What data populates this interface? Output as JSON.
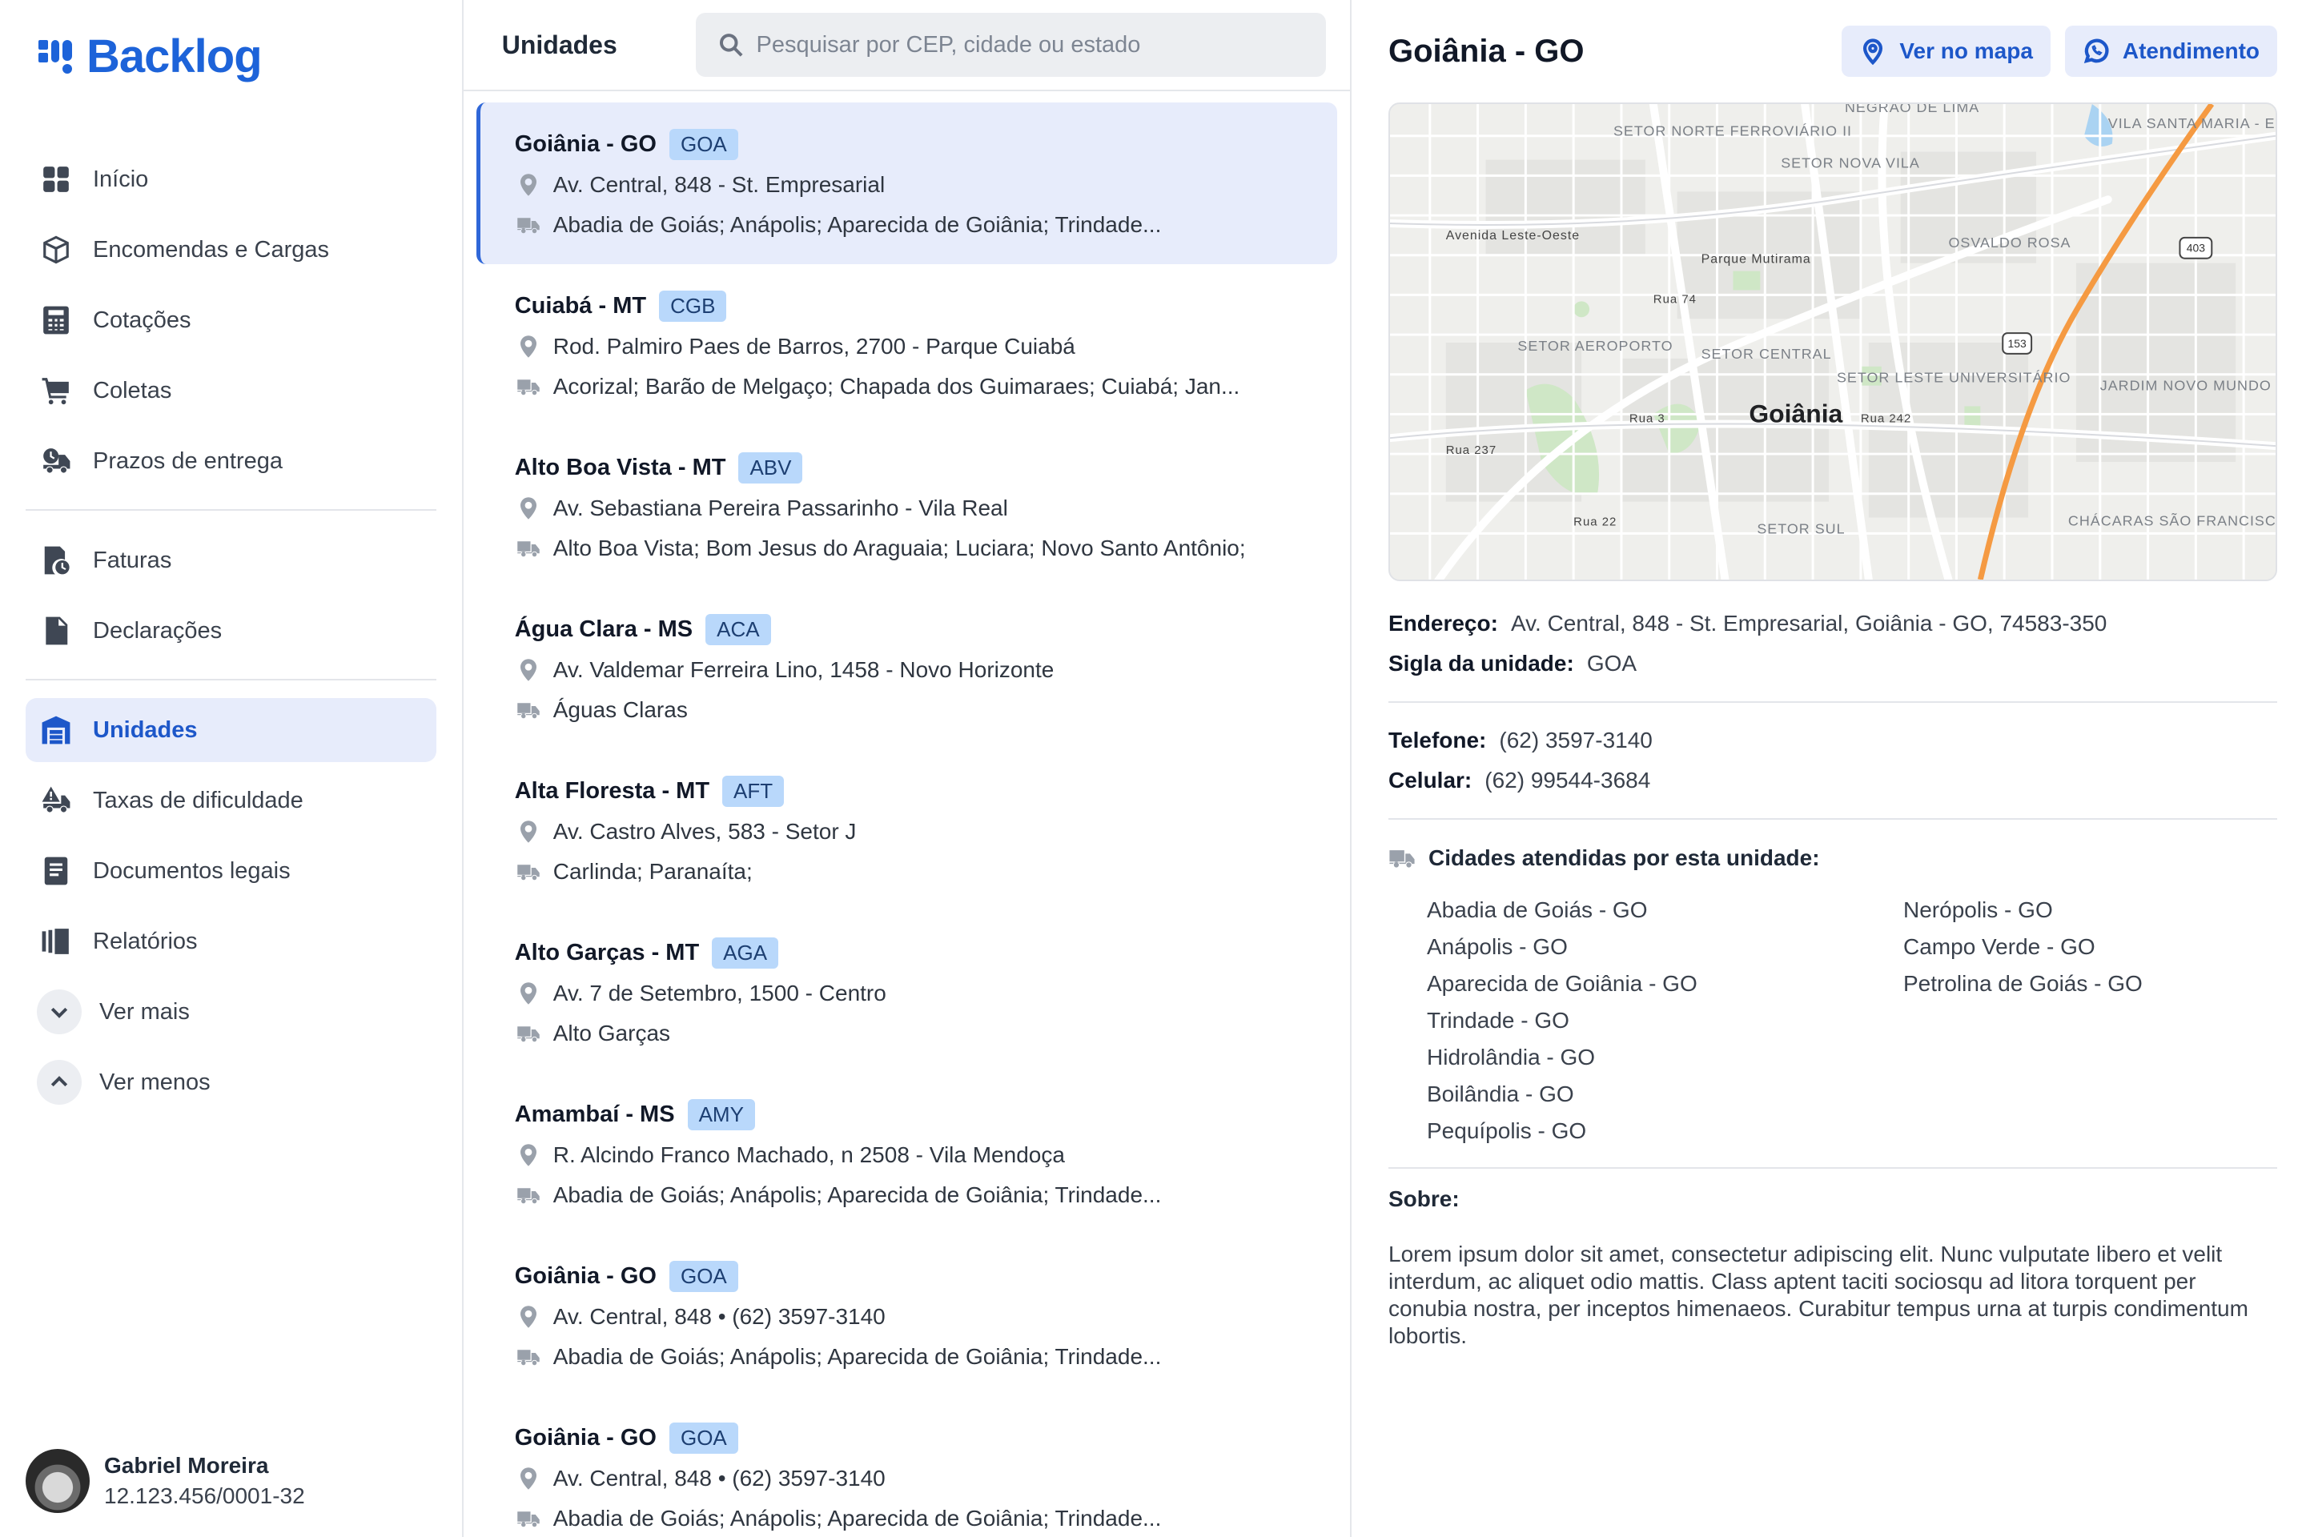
{
  "brand": {
    "name": "Backlog",
    "color": "#1d63d9"
  },
  "sidebar": {
    "items": [
      {
        "label": "Início",
        "icon": "grid-icon",
        "active": false
      },
      {
        "label": "Encomendas e Cargas",
        "icon": "box-icon",
        "active": false
      },
      {
        "label": "Cotações",
        "icon": "calculator-icon",
        "active": false
      },
      {
        "label": "Coletas",
        "icon": "cart-icon",
        "active": false
      },
      {
        "label": "Prazos de entrega",
        "icon": "truck-clock-icon",
        "active": false
      },
      {
        "label": "Faturas",
        "icon": "invoice-clock-icon",
        "active": false
      },
      {
        "label": "Declarações",
        "icon": "file-icon",
        "active": false
      },
      {
        "label": "Unidades",
        "icon": "warehouse-icon",
        "active": true
      },
      {
        "label": "Taxas de dificuldade",
        "icon": "truck-alert-icon",
        "active": false
      },
      {
        "label": "Documentos legais",
        "icon": "document-icon",
        "active": false
      },
      {
        "label": "Relatórios",
        "icon": "reports-icon",
        "active": false
      },
      {
        "label": "Ver mais",
        "icon": "chevron-down-icon",
        "active": false
      },
      {
        "label": "Ver menos",
        "icon": "chevron-up-icon",
        "active": false
      }
    ],
    "user": {
      "name": "Gabriel Moreira",
      "document": "12.123.456/0001-32"
    }
  },
  "list": {
    "title": "Unidades",
    "search_placeholder": "Pesquisar por CEP, cidade ou estado",
    "units": [
      {
        "name": "Goiânia - GO",
        "code": "GOA",
        "address": "Av. Central, 848 - St. Empresarial",
        "cities": "Abadia de Goiás; Anápolis; Aparecida de Goiânia; Trindade...",
        "selected": true
      },
      {
        "name": "Cuiabá - MT",
        "code": "CGB",
        "address": "Rod. Palmiro Paes de Barros, 2700 - Parque Cuiabá",
        "cities": "Acorizal; Barão de Melgaço; Chapada dos Guimaraes; Cuiabá; Jan...",
        "selected": false
      },
      {
        "name": "Alto Boa Vista - MT",
        "code": "ABV",
        "address": "Av. Sebastiana Pereira Passarinho - Vila Real",
        "cities": "Alto Boa Vista; Bom Jesus do Araguaia; Luciara; Novo Santo Antônio;",
        "selected": false
      },
      {
        "name": "Água Clara - MS",
        "code": "ACA",
        "address": "Av. Valdemar Ferreira Lino, 1458 - Novo Horizonte",
        "cities": "Águas Claras",
        "selected": false
      },
      {
        "name": "Alta Floresta - MT",
        "code": "AFT",
        "address": "Av. Castro Alves, 583 - Setor J",
        "cities": "Carlinda; Paranaíta;",
        "selected": false
      },
      {
        "name": "Alto Garças - MT",
        "code": "AGA",
        "address": "Av. 7 de Setembro, 1500 - Centro",
        "cities": "Alto Garças",
        "selected": false
      },
      {
        "name": "Amambaí - MS",
        "code": "AMY",
        "address": "R. Alcindo Franco Machado, n 2508 - Vila Mendoça",
        "cities": "Abadia de Goiás; Anápolis; Aparecida de Goiânia; Trindade...",
        "selected": false
      },
      {
        "name": "Goiânia - GO",
        "code": "GOA",
        "address": "Av. Central, 848 • (62) 3597-3140",
        "cities": "Abadia de Goiás; Anápolis; Aparecida de Goiânia; Trindade...",
        "selected": false
      },
      {
        "name": "Goiânia - GO",
        "code": "GOA",
        "address": "Av. Central, 848 • (62) 3597-3140",
        "cities": "Abadia de Goiás; Anápolis; Aparecida de Goiânia; Trindade...",
        "selected": false
      }
    ]
  },
  "detail": {
    "title": "Goiânia - GO",
    "map_button": "Ver no mapa",
    "support_button": "Atendimento",
    "map": {
      "city_label": "Goiânia",
      "labels": [
        "SETOR NORTE FERROVIÁRIO II",
        "SETOR NOVA VILA",
        "NEGRÃO DE LIMA",
        "VILA SANTA MARIA - EXTENSÃO",
        "Avenida Leste-Oeste",
        "Parque Mutirama",
        "OSVALDO ROSA",
        "SETOR AEROPORTO",
        "SETOR CENTRAL",
        "SETOR LESTE UNIVERSITÁRIO",
        "JARDIM NOVO MUNDO II",
        "SETOR SUL",
        "CHÁCARAS SÃO FRANCISCO DE ASSIS",
        "Rua 22",
        "Rua 3",
        "Rua 242",
        "Rua 74",
        "Rua 237",
        "403",
        "153"
      ]
    },
    "address_label": "Endereço:",
    "address": "Av. Central, 848 - St. Empresarial, Goiânia - GO, 74583-350",
    "code_label": "Sigla da unidade:",
    "code": "GOA",
    "phone_label": "Telefone:",
    "phone": "(62) 3597-3140",
    "mobile_label": "Celular:",
    "mobile": "(62) 99544-3684",
    "cities_title": "Cidades atendidas por esta unidade:",
    "cities": [
      "Abadia de Goiás - GO",
      "Anápolis - GO",
      "Aparecida de Goiânia - GO",
      "Trindade - GO",
      "Hidrolândia - GO",
      "Boilândia - GO",
      "Pequípolis - GO",
      "Nerópolis - GO",
      "Campo Verde - GO",
      "Petrolina de Goiás - GO"
    ],
    "about_title": "Sobre:",
    "about_text": "Lorem ipsum dolor sit amet, consectetur adipiscing elit. Nunc vulputate libero et velit interdum, ac aliquet odio mattis. Class aptent taciti sociosqu ad litora torquent per conubia nostra, per inceptos himenaeos. Curabitur tempus urna at turpis condimentum lobortis."
  }
}
